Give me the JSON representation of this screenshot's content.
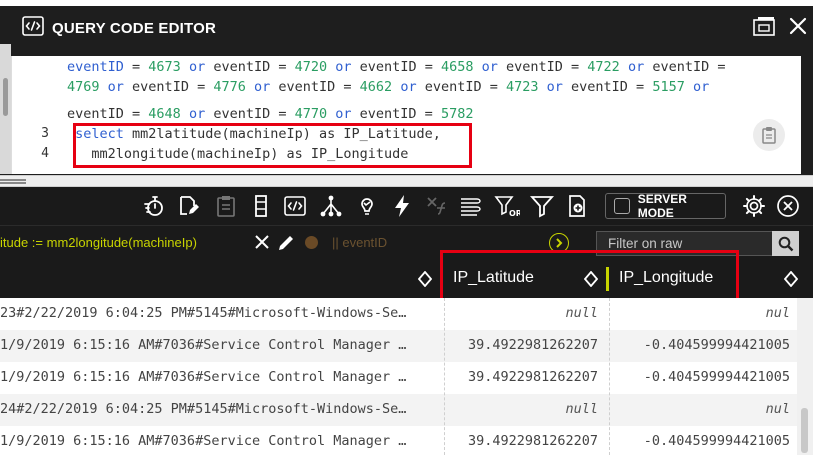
{
  "editor": {
    "title": "QUERY CODE EDITOR",
    "lines": [
      {
        "ln": "",
        "parts": [
          [
            "kw",
            "eventID"
          ],
          [
            "t",
            " = "
          ],
          [
            "num",
            "4673"
          ],
          [
            "t",
            " "
          ],
          [
            "kw",
            "or"
          ],
          [
            "t",
            " eventID = "
          ],
          [
            "num",
            "4720"
          ],
          [
            "t",
            " "
          ],
          [
            "kw",
            "or"
          ],
          [
            "t",
            " eventID = "
          ],
          [
            "num",
            "4658"
          ],
          [
            "t",
            " "
          ],
          [
            "kw",
            "or"
          ],
          [
            "t",
            " eventID = "
          ],
          [
            "num",
            "4722"
          ],
          [
            "t",
            " "
          ],
          [
            "kw",
            "or"
          ],
          [
            "t",
            " eventID ="
          ]
        ]
      },
      {
        "ln": "",
        "parts": [
          [
            "num",
            "4769"
          ],
          [
            "t",
            " "
          ],
          [
            "kw",
            "or"
          ],
          [
            "t",
            " eventID = "
          ],
          [
            "num",
            "4776"
          ],
          [
            "t",
            " "
          ],
          [
            "kw",
            "or"
          ],
          [
            "t",
            " eventID = "
          ],
          [
            "num",
            "4662"
          ],
          [
            "t",
            " "
          ],
          [
            "kw",
            "or"
          ],
          [
            "t",
            " eventID = "
          ],
          [
            "num",
            "4723"
          ],
          [
            "t",
            " "
          ],
          [
            "kw",
            "or"
          ],
          [
            "t",
            " eventID = "
          ],
          [
            "num",
            "5157"
          ],
          [
            "t",
            " "
          ],
          [
            "kw",
            "or"
          ]
        ]
      },
      {
        "ln": "",
        "parts": [
          [
            "t",
            "eventID = "
          ],
          [
            "num",
            "4648"
          ],
          [
            "t",
            " "
          ],
          [
            "kw",
            "or"
          ],
          [
            "t",
            " eventID = "
          ],
          [
            "num",
            "4770"
          ],
          [
            "t",
            " "
          ],
          [
            "kw",
            "or"
          ],
          [
            "t",
            " eventID = "
          ],
          [
            "num",
            "5782"
          ]
        ]
      },
      {
        "ln": "3",
        "parts": [
          [
            "t",
            " "
          ],
          [
            "kw",
            "select"
          ],
          [
            "t",
            " mm2latitude(machineIp) as IP_Latitude,"
          ]
        ]
      },
      {
        "ln": "4",
        "parts": [
          [
            "t",
            "   mm2longitude(machineIp) as IP_Longitude"
          ]
        ]
      }
    ]
  },
  "toolbar": {
    "server_mode_label": "SERVER MODE"
  },
  "filterbar": {
    "chip_text": "itude := mm2longitude(machineIp)",
    "event_chip": "|| eventID",
    "filter_placeholder": "Filter on raw"
  },
  "table": {
    "columns": [
      "",
      "IP_Latitude",
      "IP_Longitude"
    ],
    "rows": [
      {
        "msg": "23#2/22/2019 6:04:25 PM#5145#Microsoft-Windows-Se…",
        "lat": "null",
        "lon": "nul"
      },
      {
        "msg": "1/9/2019 6:15:16 AM#7036#Service Control Manager …",
        "lat": "39.4922981262207",
        "lon": "-0.404599994421005"
      },
      {
        "msg": "1/9/2019 6:15:16 AM#7036#Service Control Manager …",
        "lat": "39.4922981262207",
        "lon": "-0.404599994421005"
      },
      {
        "msg": "24#2/22/2019 6:04:25 PM#5145#Microsoft-Windows-Se…",
        "lat": "null",
        "lon": "nul"
      },
      {
        "msg": "1/9/2019 6:15:16 AM#7036#Service Control Manager …",
        "lat": "39.4922981262207",
        "lon": "-0.404599994421005"
      }
    ]
  },
  "colors": {
    "accent_lime": "#c8d400",
    "highlight_red": "#e60012",
    "keyword_blue": "#2f5fd0",
    "number_green": "#2a9d62",
    "panel_dark": "#1a1a1a"
  },
  "icons": [
    "code-icon",
    "maximize-window-icon",
    "close-icon",
    "clipboard-icon",
    "timer-icon",
    "edit-doc-icon",
    "paste-icon",
    "column-icon",
    "code-tag-icon",
    "tree-icon",
    "bulb-icon",
    "bolt-icon",
    "formula-off-icon",
    "stack-icon",
    "filter-or-icon",
    "filter-icon",
    "add-doc-icon",
    "gear-icon",
    "circle-close-icon",
    "pencil-icon",
    "search-icon",
    "sort-icon"
  ]
}
